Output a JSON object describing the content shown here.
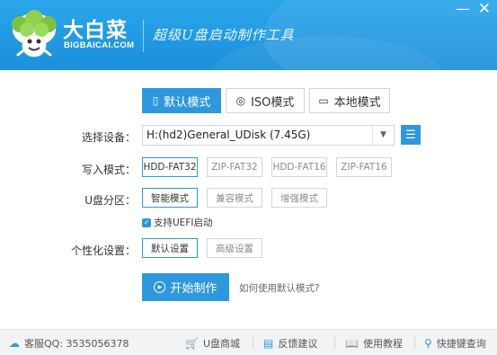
{
  "header": {
    "brand_cn": "大白菜",
    "brand_en": "BIGBAICAI.COM",
    "slogan": "超级U盘启动制作工具",
    "minimize": "—",
    "close": "✕"
  },
  "tabs": [
    {
      "label": "默认模式",
      "icon": "usb-icon",
      "glyph": "▯"
    },
    {
      "label": "ISO模式",
      "icon": "disc-icon",
      "glyph": "◎"
    },
    {
      "label": "本地模式",
      "icon": "monitor-icon",
      "glyph": "▭"
    }
  ],
  "form": {
    "device_label": "选择设备：",
    "device_value": "H:(hd2)General_UDisk (7.45G)",
    "write_label": "写入模式：",
    "write_options": [
      "HDD-FAT32",
      "ZIP-FAT32",
      "HDD-FAT16",
      "ZIP-FAT16"
    ],
    "partition_label": "U盘分区：",
    "partition_options": [
      "智能模式",
      "兼容模式",
      "增强模式"
    ],
    "uefi_label": "支持UEFI启动",
    "personalize_label": "个性化设置：",
    "personalize_options": [
      "默认设置",
      "高级设置"
    ],
    "start_button": "开始制作",
    "help_link": "如何使用默认模式?"
  },
  "footer": {
    "qq": "客服QQ:  3535056378",
    "shop": "U盘商城",
    "feedback": "反馈建议",
    "tutorial": "使用教程",
    "shortcut": "快捷键查询"
  },
  "colors": {
    "accent": "#2e97dd",
    "header_top": "#2aa6ea",
    "header_bottom": "#1b8fdb"
  }
}
